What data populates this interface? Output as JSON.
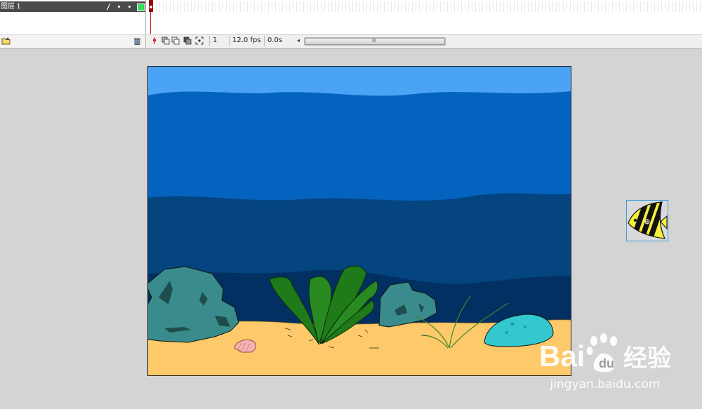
{
  "timeline": {
    "layer_name": "图层 1",
    "layer_color": "#33dd55",
    "current_frame": "1",
    "frame_rate": "12.0 fps",
    "elapsed_time": "0.0s"
  },
  "stage": {
    "colors": {
      "sky_water": "#4aa3f5",
      "water_mid": "#0563c0",
      "water_deep": "#04447f",
      "water_deepest": "#023063",
      "sand": "#fdc96a",
      "rock": "#3a8c8c",
      "seaweed": "#1f7a1a",
      "stone": "#33c8d0",
      "shell": "#f4b3b0"
    }
  },
  "selected_symbol": {
    "icon": "striped-fish-icon",
    "colors": {
      "body": "#f5f03a",
      "stripes": "#111111"
    }
  },
  "watermark": {
    "brand_prefix": "Bai",
    "brand_suffix": "经验",
    "url": "jingyan.baidu.com"
  }
}
